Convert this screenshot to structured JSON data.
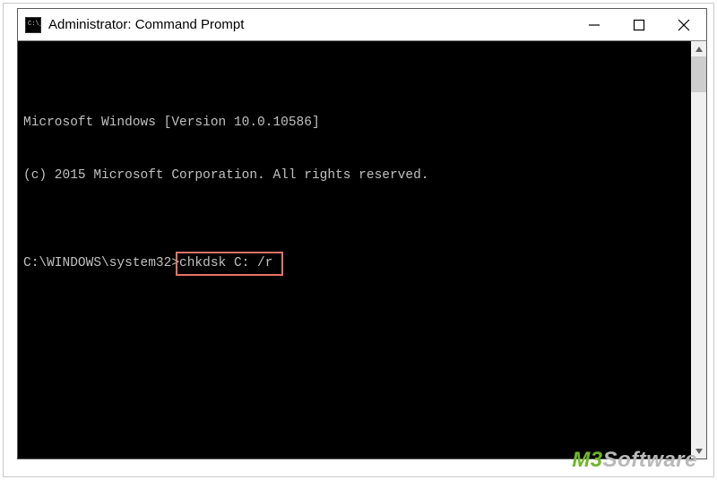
{
  "window": {
    "title": "Administrator: Command Prompt"
  },
  "terminal": {
    "line1": "Microsoft Windows [Version 10.0.10586]",
    "line2": "(c) 2015 Microsoft Corporation. All rights reserved.",
    "blank": "",
    "prompt": "C:\\WINDOWS\\system32>",
    "command": "chkdsk C: /r"
  },
  "watermark": {
    "part1": "M3",
    "part2": "Software"
  }
}
